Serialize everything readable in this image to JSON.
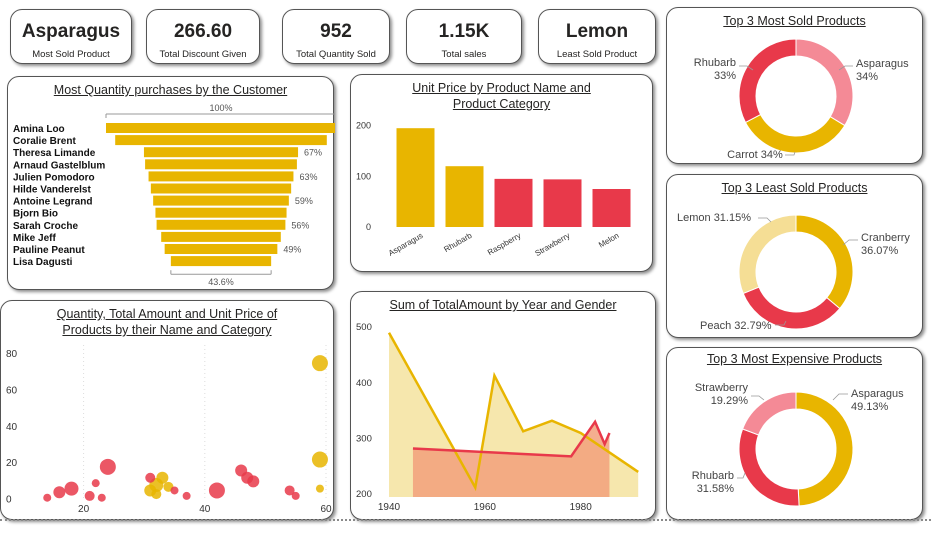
{
  "kpis": [
    {
      "value": "Asparagus",
      "label": "Most Sold Product"
    },
    {
      "value": "266.60",
      "label": "Total Discount Given"
    },
    {
      "value": "952",
      "label": "Total Quantity Sold"
    },
    {
      "value": "1.15K",
      "label": "Total sales"
    },
    {
      "value": "Lemon",
      "label": "Least Sold Product"
    }
  ],
  "colors": {
    "gold": "#E8B500",
    "gold_light": "#F5DE95",
    "gold_pale": "#F6E6A9",
    "red": "#E8394A",
    "pink": "#F48A96",
    "salmon": "#F2A07B"
  },
  "chart_data": [
    {
      "type": "funnel",
      "title": "Most Quantity purchases by the Customer",
      "top_label": "100%",
      "bottom_label": "43.6%",
      "categories": [
        "Amina Loo",
        "Coralie Brent",
        "Theresa Limande",
        "Arnaud Gastelblum",
        "Julien Pomodoro",
        "Hilde Vanderelst",
        "Antoine Legrand",
        "Bjorn Bio",
        "Sarah Croche",
        "Mike Jeff",
        "Pauline Peanut",
        "Lisa Dagusti"
      ],
      "values": [
        100,
        92,
        67,
        66,
        63,
        61,
        59,
        57,
        56,
        52,
        49,
        43.6
      ],
      "data_labels": [
        "",
        "",
        "67%",
        "",
        "63%",
        "",
        "59%",
        "",
        "56%",
        "",
        "49%",
        ""
      ]
    },
    {
      "type": "bar",
      "title": "Unit Price by Product Name and Product Category",
      "categories": [
        "Asparagus",
        "Rhubarb",
        "Raspberry",
        "Strawberry",
        "Melon"
      ],
      "values": [
        195,
        120,
        95,
        94,
        75
      ],
      "bar_colors": [
        "#E8B500",
        "#E8B500",
        "#E8394A",
        "#E8394A",
        "#E8394A"
      ],
      "yticks": [
        0,
        100,
        200
      ],
      "ylim": [
        0,
        225
      ]
    },
    {
      "type": "pie",
      "title": "Top 3 Most Sold Products",
      "labels": [
        "Asparagus",
        "Carrot",
        "Rhubarb"
      ],
      "values": [
        34,
        34,
        33
      ],
      "display": [
        "34%",
        "Carrot 34%",
        "33%"
      ],
      "colors": [
        "#F48A96",
        "#E8B500",
        "#E8394A"
      ]
    },
    {
      "type": "pie",
      "title": "Top 3 Least Sold Products",
      "labels": [
        "Cranberry",
        "Peach",
        "Lemon"
      ],
      "values": [
        36.07,
        32.79,
        31.15
      ],
      "display": [
        "36.07%",
        "Peach 32.79%",
        "Lemon 31.15%"
      ],
      "colors": [
        "#E8B500",
        "#E8394A",
        "#F5DE95"
      ]
    },
    {
      "type": "pie",
      "title": "Top 3 Most Expensive Products",
      "labels": [
        "Asparagus",
        "Rhubarb",
        "Strawberry"
      ],
      "values": [
        49.13,
        31.58,
        19.29
      ],
      "display": [
        "49.13%",
        "31.58%",
        "19.29%"
      ],
      "colors": [
        "#E8B500",
        "#E8394A",
        "#F48A96"
      ]
    },
    {
      "type": "scatter",
      "title": "Quantity, Total Amount and Unit Price of Products by their Name and Category",
      "xticks": [
        20,
        40,
        60
      ],
      "yticks": [
        0,
        20,
        40,
        60,
        80
      ],
      "xlim": [
        10,
        60
      ],
      "ylim": [
        -3,
        85
      ],
      "points": [
        {
          "x": 59,
          "y": 75,
          "r": 8,
          "c": "gold"
        },
        {
          "x": 59,
          "y": 22,
          "r": 8,
          "c": "gold"
        },
        {
          "x": 59,
          "y": 6,
          "r": 4,
          "c": "gold"
        },
        {
          "x": 16,
          "y": 4,
          "r": 6,
          "c": "red"
        },
        {
          "x": 18,
          "y": 6,
          "r": 7,
          "c": "red"
        },
        {
          "x": 14,
          "y": 1,
          "r": 4,
          "c": "red"
        },
        {
          "x": 21,
          "y": 2,
          "r": 5,
          "c": "red"
        },
        {
          "x": 23,
          "y": 1,
          "r": 4,
          "c": "red"
        },
        {
          "x": 24,
          "y": 18,
          "r": 8,
          "c": "red"
        },
        {
          "x": 22,
          "y": 9,
          "r": 4,
          "c": "red"
        },
        {
          "x": 31,
          "y": 5,
          "r": 6,
          "c": "gold"
        },
        {
          "x": 32,
          "y": 8,
          "r": 7,
          "c": "gold"
        },
        {
          "x": 32,
          "y": 3,
          "r": 5,
          "c": "gold"
        },
        {
          "x": 33,
          "y": 12,
          "r": 6,
          "c": "gold"
        },
        {
          "x": 34,
          "y": 7,
          "r": 5,
          "c": "gold"
        },
        {
          "x": 31,
          "y": 12,
          "r": 5,
          "c": "red"
        },
        {
          "x": 35,
          "y": 5,
          "r": 4,
          "c": "red"
        },
        {
          "x": 37,
          "y": 2,
          "r": 4,
          "c": "red"
        },
        {
          "x": 42,
          "y": 5,
          "r": 8,
          "c": "red"
        },
        {
          "x": 46,
          "y": 16,
          "r": 6,
          "c": "red"
        },
        {
          "x": 47,
          "y": 12,
          "r": 6,
          "c": "red"
        },
        {
          "x": 48,
          "y": 10,
          "r": 6,
          "c": "red"
        },
        {
          "x": 54,
          "y": 5,
          "r": 5,
          "c": "red"
        },
        {
          "x": 55,
          "y": 2,
          "r": 4,
          "c": "red"
        }
      ]
    },
    {
      "type": "area",
      "title": "Sum of TotalAmount by Year and Gender",
      "xticks": [
        1940,
        1960,
        1980
      ],
      "yticks": [
        200,
        300,
        400,
        500
      ],
      "xlim": [
        1940,
        1993
      ],
      "ylim": [
        195,
        520
      ],
      "series": [
        {
          "color": "gold",
          "points": [
            [
              1940,
              490
            ],
            [
              1958,
              212
            ],
            [
              1962,
              413
            ],
            [
              1968,
              313
            ],
            [
              1974,
              332
            ],
            [
              1980,
              310
            ],
            [
              1992,
              240
            ]
          ]
        },
        {
          "color": "red",
          "points": [
            [
              1945,
              282
            ],
            [
              1978,
              268
            ],
            [
              1983,
              330
            ],
            [
              1985,
              290
            ],
            [
              1986,
              310
            ]
          ]
        }
      ]
    }
  ]
}
